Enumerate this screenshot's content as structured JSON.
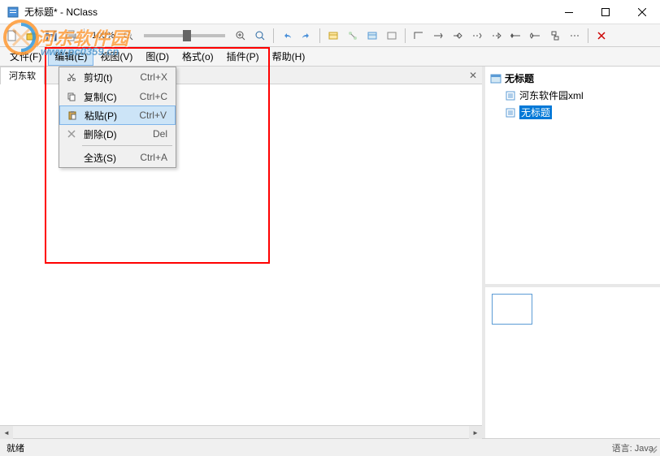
{
  "title": "无标题* - NClass",
  "toolbar": {
    "zoom_text": "100%"
  },
  "menus": {
    "file": "文件(F)",
    "edit": "编辑(E)",
    "view": "视图(V)",
    "diagram": "图(D)",
    "format": "格式(o)",
    "plugin": "插件(P)",
    "help": "帮助(H)"
  },
  "context_menu": {
    "cut": {
      "label": "剪切(t)",
      "shortcut": "Ctrl+X"
    },
    "copy": {
      "label": "复制(C)",
      "shortcut": "Ctrl+C"
    },
    "paste": {
      "label": "粘贴(P)",
      "shortcut": "Ctrl+V"
    },
    "delete": {
      "label": "删除(D)",
      "shortcut": "Del"
    },
    "select_all": {
      "label": "全选(S)",
      "shortcut": "Ctrl+A"
    }
  },
  "tab": {
    "label": "河东软"
  },
  "tree": {
    "root": "无标题",
    "items": [
      {
        "label": "河东软件园xml"
      },
      {
        "label": "无标题"
      }
    ]
  },
  "status": {
    "left": "就绪",
    "right": "语言: Java"
  },
  "watermark": {
    "text": "河东软件园",
    "url": "www.pc0359.cn"
  }
}
